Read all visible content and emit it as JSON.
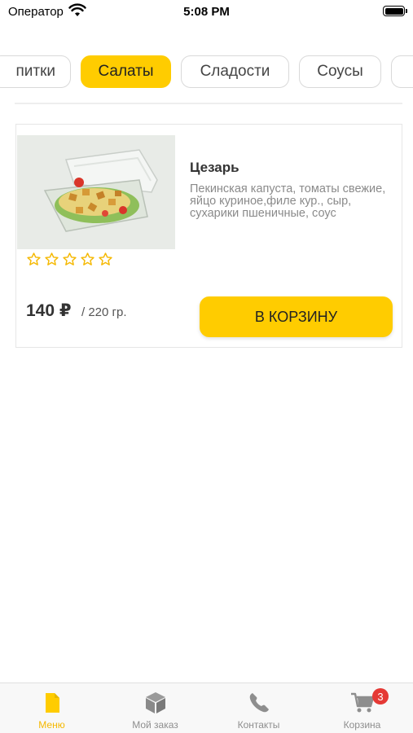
{
  "status_bar": {
    "carrier": "Оператор",
    "time": "5:08 PM"
  },
  "categories": [
    {
      "label": "питки",
      "active": false
    },
    {
      "label": "Салаты",
      "active": true
    },
    {
      "label": "Сладости",
      "active": false
    },
    {
      "label": "Соусы",
      "active": false
    },
    {
      "label": "",
      "active": false
    }
  ],
  "product": {
    "title": "Цезарь",
    "description": "Пекинская капуста, томаты свежие, яйцо куриное,филе кур., сыр, сухарики пшеничные, соус",
    "rating": 0,
    "rating_max": 5,
    "price": "140 ₽",
    "weight": "/ 220 гр.",
    "cart_button": "В КОРЗИНУ"
  },
  "tabbar": {
    "items": [
      {
        "label": "Меню",
        "icon": "document-icon",
        "active": true
      },
      {
        "label": "Мой заказ",
        "icon": "box-icon",
        "active": false
      },
      {
        "label": "Контакты",
        "icon": "phone-icon",
        "active": false
      },
      {
        "label": "Корзина",
        "icon": "cart-icon",
        "active": false
      }
    ],
    "cart_badge": "3"
  },
  "colors": {
    "accent": "#ffcc00",
    "accent_text": "#f5b800",
    "badge": "#e53935",
    "inactive_icon": "#8e8e8e"
  }
}
